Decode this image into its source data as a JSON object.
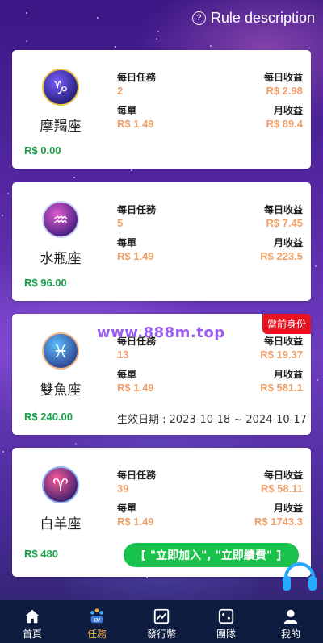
{
  "header": {
    "rule_link": "Rule description"
  },
  "labels": {
    "daily_tasks": "每日任務",
    "per_order": "每單",
    "daily_income": "每日收益",
    "monthly_income": "月收益"
  },
  "cards": [
    {
      "sign": "摩羯座",
      "icon": "capricorn-icon",
      "price": "R$ 0.00",
      "daily_tasks": "2",
      "per_order": "R$ 1.49",
      "daily_income": "R$ 2.98",
      "monthly_income": "R$ 89.4"
    },
    {
      "sign": "水瓶座",
      "icon": "aquarius-icon",
      "price": "R$ 96.00",
      "daily_tasks": "5",
      "per_order": "R$ 1.49",
      "daily_income": "R$ 7.45",
      "monthly_income": "R$ 223.5"
    },
    {
      "sign": "雙魚座",
      "icon": "pisces-icon",
      "price": "R$ 240.00",
      "daily_tasks": "13",
      "per_order": "R$ 1.49",
      "daily_income": "R$ 19.37",
      "monthly_income": "R$ 581.1",
      "badge": "當前身份",
      "validity": "生效日期 : 2023-10-18 ~ 2024-10-17"
    },
    {
      "sign": "白羊座",
      "icon": "aries-icon",
      "price": "R$ 480",
      "daily_tasks": "39",
      "per_order": "R$ 1.49",
      "daily_income": "R$ 58.11",
      "monthly_income": "R$ 1743.3",
      "button": "[ \"立即加入\", \"立即續費\" ]"
    }
  ],
  "watermark": "www.888m.top",
  "tabs": [
    {
      "label": "首頁",
      "icon": "home-icon",
      "active": false
    },
    {
      "label": "任務",
      "icon": "task-icon",
      "active": true
    },
    {
      "label": "發行幣",
      "icon": "chart-icon",
      "active": false
    },
    {
      "label": "團隊",
      "icon": "team-icon",
      "active": false
    },
    {
      "label": "我的",
      "icon": "user-icon",
      "active": false
    }
  ],
  "colors": {
    "green": "#1aa048",
    "orange": "#f0a06a",
    "tab_bg": "#0e1d3f",
    "tab_active": "#f0b24a",
    "badge": "#e8131f",
    "button": "#19c24a"
  }
}
